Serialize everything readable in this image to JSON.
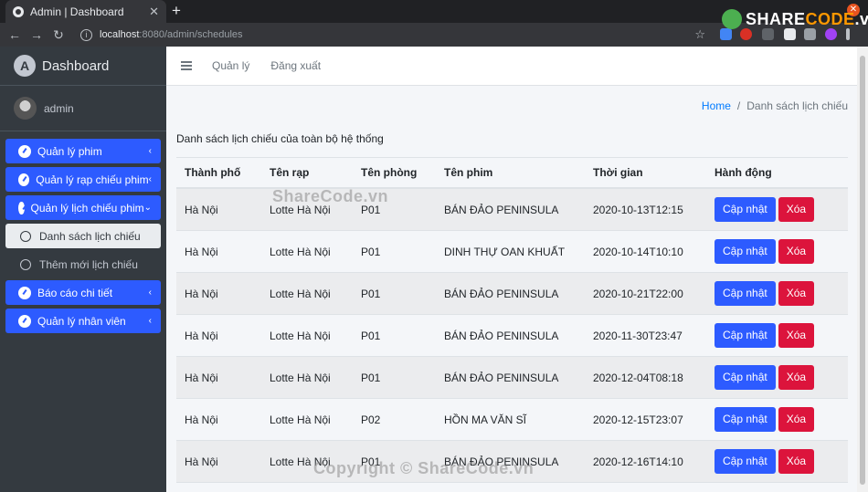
{
  "browser": {
    "tab_title": "Admin | Dashboard",
    "tab_close": "✕",
    "new_tab": "+",
    "url_host": "localhost",
    "url_path": ":8080/admin/schedules",
    "window_close": "✕"
  },
  "logo_watermark": {
    "part1": "SHARE",
    "part2": "CODE",
    "part3": ".vn"
  },
  "sidebar": {
    "brand": "Dashboard",
    "brand_initial": "A",
    "user": "admin",
    "menu": [
      {
        "label": "Quản lý phim",
        "chevron": "‹"
      },
      {
        "label": "Quản lý rạp chiếu phim",
        "chevron": "‹"
      },
      {
        "label": "Quản lý lịch chiếu phim",
        "chevron": "⌄"
      },
      {
        "label": "Danh sách lịch chiếu"
      },
      {
        "label": "Thêm mới lịch chiếu"
      },
      {
        "label": "Báo cáo chi tiết",
        "chevron": "‹"
      },
      {
        "label": "Quản lý nhân viên",
        "chevron": "‹"
      }
    ]
  },
  "topnav": {
    "links": [
      "Quản lý",
      "Đăng xuất"
    ]
  },
  "breadcrumb": {
    "home": "Home",
    "separator": "/",
    "current": "Danh sách lịch chiếu"
  },
  "page": {
    "title": "Danh sách lịch chiếu của toàn bộ hệ thống"
  },
  "table": {
    "headers": [
      "Thành phố",
      "Tên rạp",
      "Tên phòng",
      "Tên phim",
      "Thời gian",
      "Hành động"
    ],
    "rows": [
      [
        "Hà Nội",
        "Lotte Hà Nội",
        "P01",
        "BÁN ĐẢO PENINSULA",
        "2020-10-13T12:15"
      ],
      [
        "Hà Nội",
        "Lotte Hà Nội",
        "P01",
        "DINH THỰ OAN KHUẤT",
        "2020-10-14T10:10"
      ],
      [
        "Hà Nội",
        "Lotte Hà Nội",
        "P01",
        "BÁN ĐẢO PENINSULA",
        "2020-10-21T22:00"
      ],
      [
        "Hà Nội",
        "Lotte Hà Nội",
        "P01",
        "BÁN ĐẢO PENINSULA",
        "2020-11-30T23:47"
      ],
      [
        "Hà Nội",
        "Lotte Hà Nội",
        "P01",
        "BÁN ĐẢO PENINSULA",
        "2020-12-04T08:18"
      ],
      [
        "Hà Nội",
        "Lotte Hà Nội",
        "P02",
        "HỒN MA VĂN SĨ",
        "2020-12-15T23:07"
      ],
      [
        "Hà Nội",
        "Lotte Hà Nội",
        "P01",
        "BÁN ĐẢO PENINSULA",
        "2020-12-16T14:10"
      ]
    ],
    "actions": {
      "update": "Cập nhật",
      "delete": "Xóa"
    }
  },
  "watermarks": {
    "center": "ShareCode.vn",
    "bottom": "Copyright © ShareCode.vn"
  },
  "colors": {
    "primary": "#2d5bff",
    "danger": "#dc143c",
    "sidebar": "#343a40"
  }
}
